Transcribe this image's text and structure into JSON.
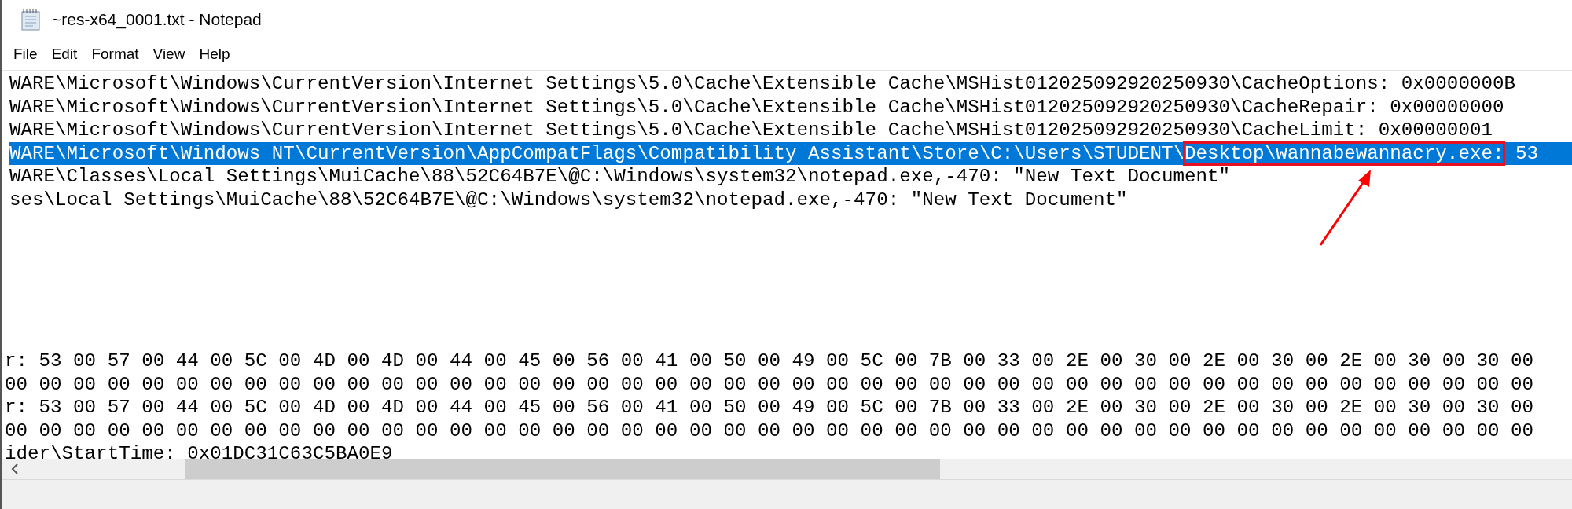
{
  "window": {
    "title": "~res-x64_0001.txt - Notepad"
  },
  "menu": [
    {
      "label": "File"
    },
    {
      "label": "Edit"
    },
    {
      "label": "Format"
    },
    {
      "label": "View"
    },
    {
      "label": "Help"
    }
  ],
  "editor": {
    "lines": [
      {
        "selected": false,
        "segments": [
          {
            "text": "WARE\\Microsoft\\Windows\\CurrentVersion\\Internet Settings\\5.0\\Cache\\Extensible Cache\\MSHist012025092920250930\\CacheOptions: 0x0000000B",
            "boxed": false
          }
        ]
      },
      {
        "selected": false,
        "segments": [
          {
            "text": "WARE\\Microsoft\\Windows\\CurrentVersion\\Internet Settings\\5.0\\Cache\\Extensible Cache\\MSHist012025092920250930\\CacheRepair: 0x00000000",
            "boxed": false
          }
        ]
      },
      {
        "selected": false,
        "segments": [
          {
            "text": "WARE\\Microsoft\\Windows\\CurrentVersion\\Internet Settings\\5.0\\Cache\\Extensible Cache\\MSHist012025092920250930\\CacheLimit: 0x00000001",
            "boxed": false
          }
        ]
      },
      {
        "selected": true,
        "segments": [
          {
            "text": "WARE\\Microsoft\\Windows NT\\CurrentVersion\\AppCompatFlags\\Compatibility Assistant\\Store\\C:\\Users\\STUDENT\\",
            "boxed": false
          },
          {
            "text": "Desktop\\wannabewannacry.exe:",
            "boxed": true
          },
          {
            "text": " 53",
            "boxed": false
          }
        ]
      },
      {
        "selected": false,
        "segments": [
          {
            "text": "WARE\\Classes\\Local Settings\\MuiCache\\88\\52C64B7E\\@C:\\Windows\\system32\\notepad.exe,-470: \"New Text Document\"",
            "boxed": false
          }
        ]
      },
      {
        "selected": false,
        "segments": [
          {
            "text": "ses\\Local Settings\\MuiCache\\88\\52C64B7E\\@C:\\Windows\\system32\\notepad.exe,-470: \"New Text Document\"",
            "boxed": false
          }
        ]
      }
    ],
    "lower_lines": [
      {
        "selected": false,
        "segments": [
          {
            "text": "r: 53 00 57 00 44 00 5C 00 4D 00 4D 00 44 00 45 00 56 00 41 00 50 00 49 00 5C 00 7B 00 33 00 2E 00 30 00 2E 00 30 00 2E 00 30 00 30 00",
            "boxed": false
          }
        ]
      },
      {
        "selected": false,
        "segments": [
          {
            "text": "00 00 00 00 00 00 00 00 00 00 00 00 00 00 00 00 00 00 00 00 00 00 00 00 00 00 00 00 00 00 00 00 00 00 00 00 00 00 00 00 00 00 00 00 00",
            "boxed": false
          }
        ]
      },
      {
        "selected": false,
        "segments": [
          {
            "text": "r: 53 00 57 00 44 00 5C 00 4D 00 4D 00 44 00 45 00 56 00 41 00 50 00 49 00 5C 00 7B 00 33 00 2E 00 30 00 2E 00 30 00 2E 00 30 00 30 00",
            "boxed": false
          }
        ]
      },
      {
        "selected": false,
        "segments": [
          {
            "text": "00 00 00 00 00 00 00 00 00 00 00 00 00 00 00 00 00 00 00 00 00 00 00 00 00 00 00 00 00 00 00 00 00 00 00 00 00 00 00 00 00 00 00 00 00",
            "boxed": false
          }
        ]
      },
      {
        "selected": false,
        "segments": [
          {
            "text": "ider\\StartTime: 0x01DC31C63C5BA0E9",
            "boxed": false
          }
        ]
      }
    ]
  },
  "annotation": {
    "kind": "arrow"
  }
}
